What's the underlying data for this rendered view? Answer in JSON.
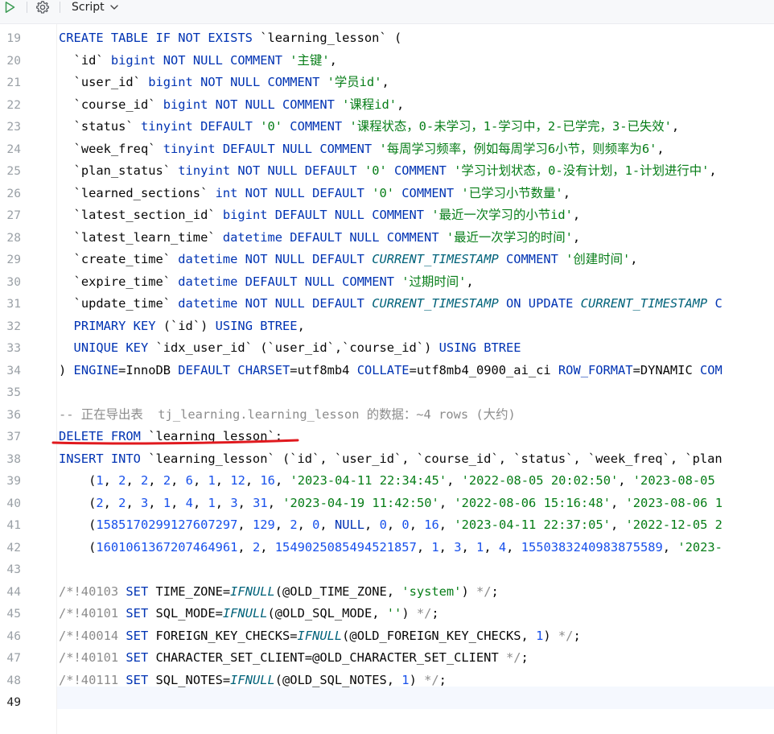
{
  "toolbar": {
    "run_icon": "run-icon",
    "settings_icon": "gear-icon",
    "script_label": "Script",
    "dropdown_icon": "chevron-down-icon"
  },
  "editor": {
    "current_line": 49,
    "lines": [
      {
        "n": 19,
        "segs": [
          {
            "k": "kw",
            "t": "CREATE TABLE IF NOT EXISTS "
          },
          {
            "k": "bt",
            "t": "`learning_lesson`"
          },
          {
            "k": "plain",
            "t": " ("
          }
        ]
      },
      {
        "n": 20,
        "segs": [
          {
            "k": "plain",
            "t": "  "
          },
          {
            "k": "bt",
            "t": "`id`"
          },
          {
            "k": "kw",
            "t": " bigint NOT NULL COMMENT "
          },
          {
            "k": "str",
            "t": "'主键'"
          },
          {
            "k": "plain",
            "t": ","
          }
        ]
      },
      {
        "n": 21,
        "segs": [
          {
            "k": "plain",
            "t": "  "
          },
          {
            "k": "bt",
            "t": "`user_id`"
          },
          {
            "k": "kw",
            "t": " bigint NOT NULL COMMENT "
          },
          {
            "k": "str",
            "t": "'学员id'"
          },
          {
            "k": "plain",
            "t": ","
          }
        ]
      },
      {
        "n": 22,
        "segs": [
          {
            "k": "plain",
            "t": "  "
          },
          {
            "k": "bt",
            "t": "`course_id`"
          },
          {
            "k": "kw",
            "t": " bigint NOT NULL COMMENT "
          },
          {
            "k": "str",
            "t": "'课程id'"
          },
          {
            "k": "plain",
            "t": ","
          }
        ]
      },
      {
        "n": 23,
        "segs": [
          {
            "k": "plain",
            "t": "  "
          },
          {
            "k": "bt",
            "t": "`status`"
          },
          {
            "k": "kw",
            "t": " tinyint DEFAULT "
          },
          {
            "k": "str",
            "t": "'0'"
          },
          {
            "k": "kw",
            "t": " COMMENT "
          },
          {
            "k": "str",
            "t": "'课程状态，0-未学习，1-学习中，2-已学完，3-已失效'"
          },
          {
            "k": "plain",
            "t": ","
          }
        ]
      },
      {
        "n": 24,
        "segs": [
          {
            "k": "plain",
            "t": "  "
          },
          {
            "k": "bt",
            "t": "`week_freq`"
          },
          {
            "k": "kw",
            "t": " tinyint DEFAULT NULL COMMENT "
          },
          {
            "k": "str",
            "t": "'每周学习频率，例如每周学习6小节，则频率为6'"
          },
          {
            "k": "plain",
            "t": ","
          }
        ]
      },
      {
        "n": 25,
        "segs": [
          {
            "k": "plain",
            "t": "  "
          },
          {
            "k": "bt",
            "t": "`plan_status`"
          },
          {
            "k": "kw",
            "t": " tinyint NOT NULL DEFAULT "
          },
          {
            "k": "str",
            "t": "'0'"
          },
          {
            "k": "kw",
            "t": " COMMENT "
          },
          {
            "k": "str",
            "t": "'学习计划状态，0-没有计划，1-计划进行中'"
          },
          {
            "k": "plain",
            "t": ","
          }
        ]
      },
      {
        "n": 26,
        "segs": [
          {
            "k": "plain",
            "t": "  "
          },
          {
            "k": "bt",
            "t": "`learned_sections`"
          },
          {
            "k": "kw",
            "t": " int NOT NULL DEFAULT "
          },
          {
            "k": "str",
            "t": "'0'"
          },
          {
            "k": "kw",
            "t": " COMMENT "
          },
          {
            "k": "str",
            "t": "'已学习小节数量'"
          },
          {
            "k": "plain",
            "t": ","
          }
        ]
      },
      {
        "n": 27,
        "segs": [
          {
            "k": "plain",
            "t": "  "
          },
          {
            "k": "bt",
            "t": "`latest_section_id`"
          },
          {
            "k": "kw",
            "t": " bigint DEFAULT NULL COMMENT "
          },
          {
            "k": "str",
            "t": "'最近一次学习的小节id'"
          },
          {
            "k": "plain",
            "t": ","
          }
        ]
      },
      {
        "n": 28,
        "segs": [
          {
            "k": "plain",
            "t": "  "
          },
          {
            "k": "bt",
            "t": "`latest_learn_time`"
          },
          {
            "k": "kw",
            "t": " datetime DEFAULT NULL COMMENT "
          },
          {
            "k": "str",
            "t": "'最近一次学习的时间'"
          },
          {
            "k": "plain",
            "t": ","
          }
        ]
      },
      {
        "n": 29,
        "segs": [
          {
            "k": "plain",
            "t": "  "
          },
          {
            "k": "bt",
            "t": "`create_time`"
          },
          {
            "k": "kw",
            "t": " datetime NOT NULL DEFAULT "
          },
          {
            "k": "fn",
            "t": "CURRENT_TIMESTAMP"
          },
          {
            "k": "kw",
            "t": " COMMENT "
          },
          {
            "k": "str",
            "t": "'创建时间'"
          },
          {
            "k": "plain",
            "t": ","
          }
        ]
      },
      {
        "n": 30,
        "segs": [
          {
            "k": "plain",
            "t": "  "
          },
          {
            "k": "bt",
            "t": "`expire_time`"
          },
          {
            "k": "kw",
            "t": " datetime DEFAULT NULL COMMENT "
          },
          {
            "k": "str",
            "t": "'过期时间'"
          },
          {
            "k": "plain",
            "t": ","
          }
        ]
      },
      {
        "n": 31,
        "segs": [
          {
            "k": "plain",
            "t": "  "
          },
          {
            "k": "bt",
            "t": "`update_time`"
          },
          {
            "k": "kw",
            "t": " datetime NOT NULL DEFAULT "
          },
          {
            "k": "fn",
            "t": "CURRENT_TIMESTAMP"
          },
          {
            "k": "kw",
            "t": " ON UPDATE "
          },
          {
            "k": "fn",
            "t": "CURRENT_TIMESTAMP"
          },
          {
            "k": "kw",
            "t": " C"
          }
        ]
      },
      {
        "n": 32,
        "segs": [
          {
            "k": "plain",
            "t": "  "
          },
          {
            "k": "kw",
            "t": "PRIMARY KEY "
          },
          {
            "k": "plain",
            "t": "(`id`) "
          },
          {
            "k": "kw",
            "t": "USING BTREE"
          },
          {
            "k": "plain",
            "t": ","
          }
        ]
      },
      {
        "n": 33,
        "segs": [
          {
            "k": "plain",
            "t": "  "
          },
          {
            "k": "kw",
            "t": "UNIQUE KEY "
          },
          {
            "k": "bt",
            "t": "`idx_user_id`"
          },
          {
            "k": "plain",
            "t": " (`user_id`,`course_id`) "
          },
          {
            "k": "kw",
            "t": "USING BTREE"
          }
        ]
      },
      {
        "n": 34,
        "segs": [
          {
            "k": "plain",
            "t": ") "
          },
          {
            "k": "kw",
            "t": "ENGINE"
          },
          {
            "k": "plain",
            "t": "=InnoDB "
          },
          {
            "k": "kw",
            "t": "DEFAULT CHARSET"
          },
          {
            "k": "plain",
            "t": "=utf8mb4 "
          },
          {
            "k": "kw",
            "t": "COLLATE"
          },
          {
            "k": "plain",
            "t": "=utf8mb4_0900_ai_ci "
          },
          {
            "k": "kw",
            "t": "ROW_FORMAT"
          },
          {
            "k": "plain",
            "t": "=DYNAMIC "
          },
          {
            "k": "kw",
            "t": "COM"
          }
        ]
      },
      {
        "n": 35,
        "segs": []
      },
      {
        "n": 36,
        "segs": [
          {
            "k": "cmt",
            "t": "-- 正在导出表  tj_learning.learning_lesson 的数据：~4 rows (大约)"
          }
        ]
      },
      {
        "n": 37,
        "segs": [
          {
            "k": "kw",
            "t": "DELETE FROM "
          },
          {
            "k": "bt",
            "t": "`learning_lesson`"
          },
          {
            "k": "plain",
            "t": ";"
          }
        ]
      },
      {
        "n": 38,
        "segs": [
          {
            "k": "kw",
            "t": "INSERT INTO "
          },
          {
            "k": "bt",
            "t": "`learning_lesson`"
          },
          {
            "k": "plain",
            "t": " (`id`, `user_id`, `course_id`, `status`, `week_freq`, `plan"
          }
        ]
      },
      {
        "n": 39,
        "segs": [
          {
            "k": "plain",
            "t": "    ("
          },
          {
            "k": "num",
            "t": "1"
          },
          {
            "k": "plain",
            "t": ", "
          },
          {
            "k": "num",
            "t": "2"
          },
          {
            "k": "plain",
            "t": ", "
          },
          {
            "k": "num",
            "t": "2"
          },
          {
            "k": "plain",
            "t": ", "
          },
          {
            "k": "num",
            "t": "2"
          },
          {
            "k": "plain",
            "t": ", "
          },
          {
            "k": "num",
            "t": "6"
          },
          {
            "k": "plain",
            "t": ", "
          },
          {
            "k": "num",
            "t": "1"
          },
          {
            "k": "plain",
            "t": ", "
          },
          {
            "k": "num",
            "t": "12"
          },
          {
            "k": "plain",
            "t": ", "
          },
          {
            "k": "num",
            "t": "16"
          },
          {
            "k": "plain",
            "t": ", "
          },
          {
            "k": "str",
            "t": "'2023-04-11 22:34:45'"
          },
          {
            "k": "plain",
            "t": ", "
          },
          {
            "k": "str",
            "t": "'2022-08-05 20:02:50'"
          },
          {
            "k": "plain",
            "t": ", "
          },
          {
            "k": "str",
            "t": "'2023-08-05"
          }
        ]
      },
      {
        "n": 40,
        "segs": [
          {
            "k": "plain",
            "t": "    ("
          },
          {
            "k": "num",
            "t": "2"
          },
          {
            "k": "plain",
            "t": ", "
          },
          {
            "k": "num",
            "t": "2"
          },
          {
            "k": "plain",
            "t": ", "
          },
          {
            "k": "num",
            "t": "3"
          },
          {
            "k": "plain",
            "t": ", "
          },
          {
            "k": "num",
            "t": "1"
          },
          {
            "k": "plain",
            "t": ", "
          },
          {
            "k": "num",
            "t": "4"
          },
          {
            "k": "plain",
            "t": ", "
          },
          {
            "k": "num",
            "t": "1"
          },
          {
            "k": "plain",
            "t": ", "
          },
          {
            "k": "num",
            "t": "3"
          },
          {
            "k": "plain",
            "t": ", "
          },
          {
            "k": "num",
            "t": "31"
          },
          {
            "k": "plain",
            "t": ", "
          },
          {
            "k": "str",
            "t": "'2023-04-19 11:42:50'"
          },
          {
            "k": "plain",
            "t": ", "
          },
          {
            "k": "str",
            "t": "'2022-08-06 15:16:48'"
          },
          {
            "k": "plain",
            "t": ", "
          },
          {
            "k": "str",
            "t": "'2023-08-06 1"
          }
        ]
      },
      {
        "n": 41,
        "segs": [
          {
            "k": "plain",
            "t": "    ("
          },
          {
            "k": "num",
            "t": "1585170299127607297"
          },
          {
            "k": "plain",
            "t": ", "
          },
          {
            "k": "num",
            "t": "129"
          },
          {
            "k": "plain",
            "t": ", "
          },
          {
            "k": "num",
            "t": "2"
          },
          {
            "k": "plain",
            "t": ", "
          },
          {
            "k": "num",
            "t": "0"
          },
          {
            "k": "plain",
            "t": ", "
          },
          {
            "k": "kw",
            "t": "NULL"
          },
          {
            "k": "plain",
            "t": ", "
          },
          {
            "k": "num",
            "t": "0"
          },
          {
            "k": "plain",
            "t": ", "
          },
          {
            "k": "num",
            "t": "0"
          },
          {
            "k": "plain",
            "t": ", "
          },
          {
            "k": "num",
            "t": "16"
          },
          {
            "k": "plain",
            "t": ", "
          },
          {
            "k": "str",
            "t": "'2023-04-11 22:37:05'"
          },
          {
            "k": "plain",
            "t": ", "
          },
          {
            "k": "str",
            "t": "'2022-12-05 2"
          }
        ]
      },
      {
        "n": 42,
        "segs": [
          {
            "k": "plain",
            "t": "    ("
          },
          {
            "k": "num",
            "t": "1601061367207464961"
          },
          {
            "k": "plain",
            "t": ", "
          },
          {
            "k": "num",
            "t": "2"
          },
          {
            "k": "plain",
            "t": ", "
          },
          {
            "k": "num",
            "t": "1549025085494521857"
          },
          {
            "k": "plain",
            "t": ", "
          },
          {
            "k": "num",
            "t": "1"
          },
          {
            "k": "plain",
            "t": ", "
          },
          {
            "k": "num",
            "t": "3"
          },
          {
            "k": "plain",
            "t": ", "
          },
          {
            "k": "num",
            "t": "1"
          },
          {
            "k": "plain",
            "t": ", "
          },
          {
            "k": "num",
            "t": "4"
          },
          {
            "k": "plain",
            "t": ", "
          },
          {
            "k": "num",
            "t": "1550383240983875589"
          },
          {
            "k": "plain",
            "t": ", "
          },
          {
            "k": "str",
            "t": "'2023-"
          }
        ]
      },
      {
        "n": 43,
        "segs": []
      },
      {
        "n": 44,
        "segs": [
          {
            "k": "cmt",
            "t": "/*!40103 "
          },
          {
            "k": "kw",
            "t": "SET "
          },
          {
            "k": "plain",
            "t": "TIME_ZONE="
          },
          {
            "k": "fn",
            "t": "IFNULL"
          },
          {
            "k": "plain",
            "t": "(@OLD_TIME_ZONE, "
          },
          {
            "k": "str",
            "t": "'system'"
          },
          {
            "k": "plain",
            "t": ") "
          },
          {
            "k": "cmt",
            "t": "*/"
          },
          {
            "k": "plain",
            "t": ";"
          }
        ]
      },
      {
        "n": 45,
        "segs": [
          {
            "k": "cmt",
            "t": "/*!40101 "
          },
          {
            "k": "kw",
            "t": "SET "
          },
          {
            "k": "plain",
            "t": "SQL_MODE="
          },
          {
            "k": "fn",
            "t": "IFNULL"
          },
          {
            "k": "plain",
            "t": "(@OLD_SQL_MODE, "
          },
          {
            "k": "str",
            "t": "''"
          },
          {
            "k": "plain",
            "t": ") "
          },
          {
            "k": "cmt",
            "t": "*/"
          },
          {
            "k": "plain",
            "t": ";"
          }
        ]
      },
      {
        "n": 46,
        "segs": [
          {
            "k": "cmt",
            "t": "/*!40014 "
          },
          {
            "k": "kw",
            "t": "SET "
          },
          {
            "k": "plain",
            "t": "FOREIGN_KEY_CHECKS="
          },
          {
            "k": "fn",
            "t": "IFNULL"
          },
          {
            "k": "plain",
            "t": "(@OLD_FOREIGN_KEY_CHECKS, "
          },
          {
            "k": "num",
            "t": "1"
          },
          {
            "k": "plain",
            "t": ") "
          },
          {
            "k": "cmt",
            "t": "*/"
          },
          {
            "k": "plain",
            "t": ";"
          }
        ]
      },
      {
        "n": 47,
        "segs": [
          {
            "k": "cmt",
            "t": "/*!40101 "
          },
          {
            "k": "kw",
            "t": "SET "
          },
          {
            "k": "plain",
            "t": "CHARACTER_SET_CLIENT=@OLD_CHARACTER_SET_CLIENT "
          },
          {
            "k": "cmt",
            "t": "*/"
          },
          {
            "k": "plain",
            "t": ";"
          }
        ]
      },
      {
        "n": 48,
        "segs": [
          {
            "k": "cmt",
            "t": "/*!40111 "
          },
          {
            "k": "kw",
            "t": "SET "
          },
          {
            "k": "plain",
            "t": "SQL_NOTES="
          },
          {
            "k": "fn",
            "t": "IFNULL"
          },
          {
            "k": "plain",
            "t": "(@OLD_SQL_NOTES, "
          },
          {
            "k": "num",
            "t": "1"
          },
          {
            "k": "plain",
            "t": ") "
          },
          {
            "k": "cmt",
            "t": "*/"
          },
          {
            "k": "plain",
            "t": ";"
          }
        ]
      },
      {
        "n": 49,
        "segs": []
      }
    ]
  },
  "colors": {
    "keyword": "#0033b3",
    "string": "#067d17",
    "number": "#1750eb",
    "comment": "#8c8c8c",
    "function": "#00627a",
    "annotation_underline": "#e0191e"
  }
}
